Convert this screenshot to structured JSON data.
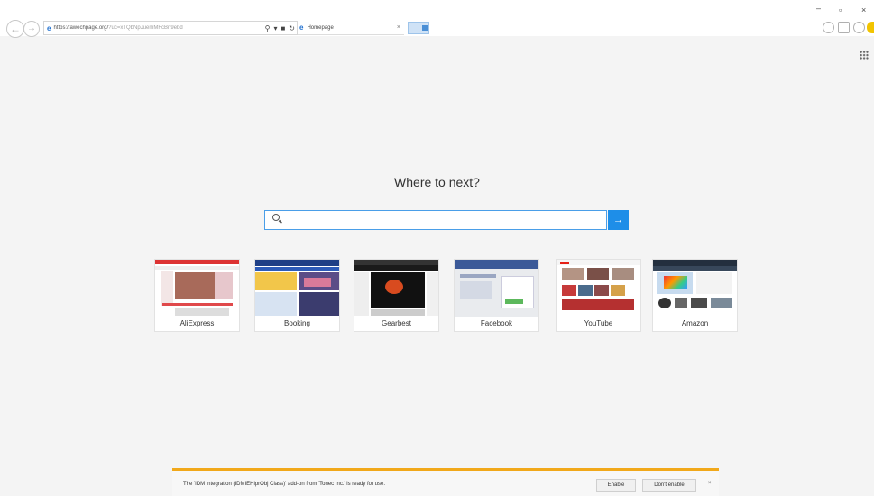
{
  "address_bar": {
    "url_main": "https://awechpage.org/",
    "url_rest": "?uc=xTQbNpJuemMFcBn9ebd",
    "search_icon": "search-icon",
    "dropdown_icon": "chevron-down-icon",
    "lock_icon": "lock-icon",
    "refresh_icon": "refresh-icon"
  },
  "tab": {
    "title": "Homepage",
    "close": "×"
  },
  "window": {
    "minimize": "–",
    "maximize": "▫",
    "close": "×"
  },
  "page": {
    "heading": "Where to next?",
    "search_placeholder": "",
    "go_label": "→"
  },
  "tiles": [
    {
      "label": "AliExpress"
    },
    {
      "label": "Booking"
    },
    {
      "label": "Gearbest"
    },
    {
      "label": "Facebook"
    },
    {
      "label": "YouTube"
    },
    {
      "label": "Amazon"
    }
  ],
  "notification": {
    "message": "The 'IDM integration (IDMIEHlprObj Class)' add-on from 'Tonec Inc.' is ready for use.",
    "enable": "Enable",
    "dont_enable": "Don't enable",
    "close": "×"
  },
  "colors": {
    "accent": "#1e8ee8",
    "notification_border": "#f1a81a"
  }
}
